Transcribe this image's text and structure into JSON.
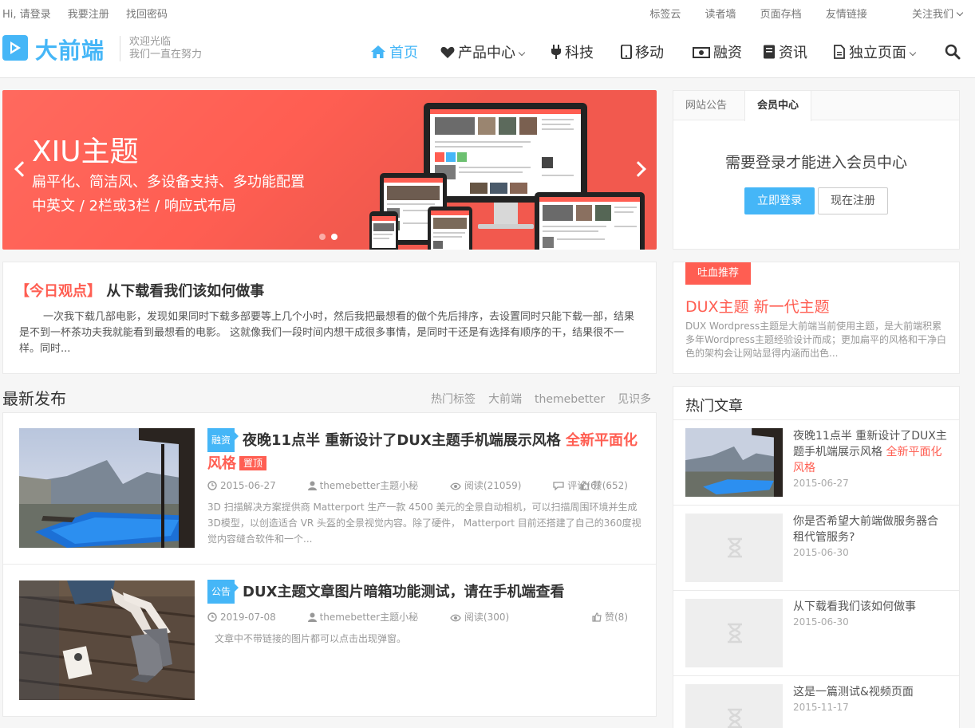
{
  "topbar": {
    "left": [
      "Hi, 请登录",
      "我要注册",
      "找回密码"
    ],
    "right": [
      "标签云",
      "读者墙",
      "页面存档",
      "友情链接",
      "关注我们"
    ]
  },
  "header": {
    "logo_text": "大前端",
    "slogan_line1": "欢迎光临",
    "slogan_line2": "我们一直在努力",
    "nav": [
      "首页",
      "产品中心",
      "科技",
      "移动",
      "融资",
      "资讯",
      "独立页面"
    ]
  },
  "slider": {
    "title": "XIU主题",
    "line1": "扁平化、简洁风、多设备支持、多功能配置",
    "line2": "中英文 / 2栏或3栏 / 响应式布局",
    "dots": 2,
    "active_dot": 2
  },
  "opinion": {
    "tag": "【今日观点】",
    "title": "从下载看我们该如何做事",
    "text": "一次我下载几部电影，发现如果同时下载多部要等上几个小时，然后我把最想看的做个先后排序，去设置同时只能下载一部，结果是不到一杯茶功夫我就能看到最想看的电影。 这就像我们一段时间内想干成很多事情，是同时干还是有选择有顺序的干，结果很不一样。同时..."
  },
  "latest": {
    "heading": "最新发布",
    "links": [
      "热门标签",
      "大前端",
      "themebetter",
      "见识多"
    ],
    "posts": [
      {
        "category": "融资",
        "title": "夜晚11点半 重新设计了DUX主题手机端展示风格",
        "highlight": "全新平面化风格",
        "badge": "置顶",
        "date": "2015-06-27",
        "author": "themebetter主题小秘",
        "views": "阅读(21059)",
        "comments": "评论(6)",
        "likes": "赞(652)",
        "excerpt": "3D 扫描解决方案提供商 Matterport 生产一款 4500 美元的全景自动相机，可以扫描周围环境并生成3D模型，以创造适合 VR 头盔的全景视觉内容。除了硬件， Matterport 目前还搭建了自己的360度视觉内容缝合软件和一个..."
      },
      {
        "category": "公告",
        "title": "DUX主题文章图片暗箱功能测试，请在手机端查看",
        "date": "2019-07-08",
        "author": "themebetter主题小秘",
        "views": "阅读(300)",
        "likes": "赞(8)",
        "excerpt": "文章中不带链接的图片都可以点击出现弹窗。"
      }
    ]
  },
  "sidebar": {
    "tabs": [
      "网站公告",
      "会员中心"
    ],
    "active_tab": "会员中心",
    "login_msg": "需要登录才能进入会员中心",
    "login_btn": "立即登录",
    "register_btn": "现在注册",
    "rec": {
      "tag": "吐血推荐",
      "title": "DUX主题 新一代主题",
      "text": "DUX Wordpress主题是大前端当前使用主题，是大前端积累多年Wordpress主题经验设计而成；更加扁平的风格和干净白色的架构会让网站显得内涵而出色..."
    },
    "hot": {
      "heading": "热门文章",
      "items": [
        {
          "title": "夜晚11点半 重新设计了DUX主题手机端展示风格",
          "highlight": "全新平面化风格",
          "date": "2015-06-27"
        },
        {
          "title": "你是否希望大前端做服务器合租代管服务?",
          "date": "2015-06-30"
        },
        {
          "title": "从下载看我们该如何做事",
          "date": "2015-06-30"
        },
        {
          "title": "这是一篇测试&视频页面",
          "date": "2015-11-17"
        }
      ]
    }
  },
  "colors": {
    "accent": "#45B6F7",
    "red": "#ff5e52"
  }
}
